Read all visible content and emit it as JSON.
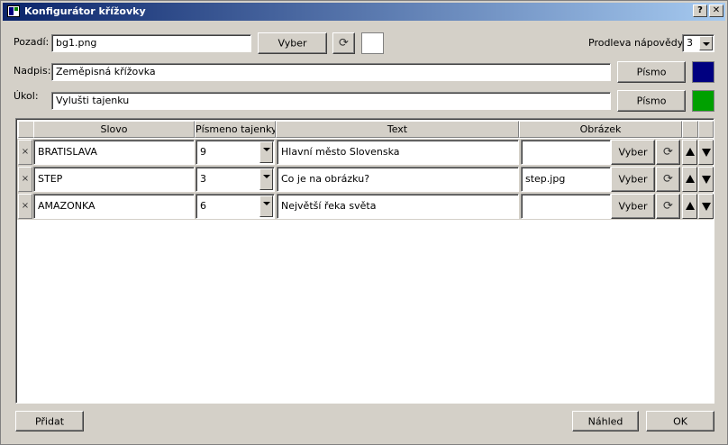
{
  "window": {
    "title": "Konfigurátor křížovky",
    "help_label": "?",
    "close_label": "✕"
  },
  "form": {
    "background_label": "Pozadí:",
    "background_value": "bg1.png",
    "select_label": "Vyber",
    "refresh_glyph": "⟳",
    "hint_delay_label": "Prodleva nápovědy:",
    "hint_delay_value": "3",
    "title_label": "Nadpis:",
    "title_value": "Zeměpisná křížovka",
    "task_label": "Úkol:",
    "task_value": "Vylušti tajenku",
    "font_label": "Písmo",
    "title_color": "#000080",
    "task_color": "#00a000",
    "bg_color": "#ffffff"
  },
  "table": {
    "headers": [
      "Slovo",
      "Písmeno tajenky",
      "Text",
      "Obrázek"
    ],
    "delete_glyph": "×",
    "rows": [
      {
        "word": "BRATISLAVA",
        "letter": "9",
        "text": "Hlavní město Slovenska",
        "image": ""
      },
      {
        "word": "STEP",
        "letter": "3",
        "text": "Co je na obrázku?",
        "image": "step.jpg"
      },
      {
        "word": "AMAZONKA",
        "letter": "6",
        "text": "Největší řeka světa",
        "image": ""
      }
    ]
  },
  "footer": {
    "add_label": "Přidat",
    "preview_label": "Náhled",
    "ok_label": "OK"
  }
}
